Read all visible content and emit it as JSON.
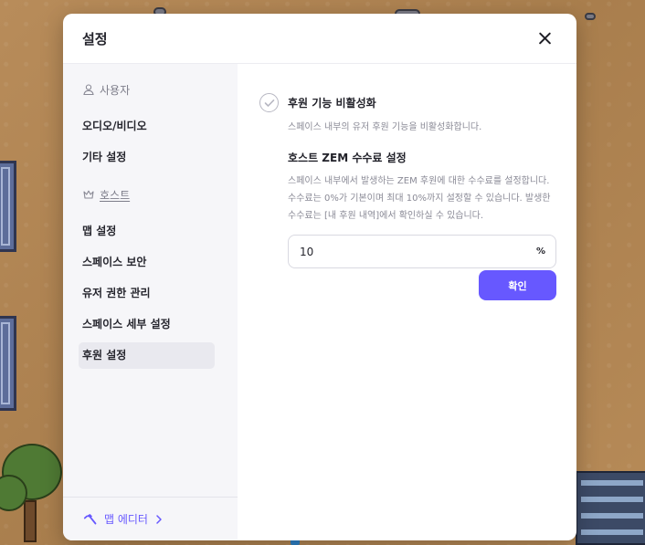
{
  "modal": {
    "title": "설정",
    "close_label": "close"
  },
  "sidebar": {
    "user_section": {
      "label": "사용자",
      "icon": "user-icon"
    },
    "user_items": [
      {
        "label": "오디오/비디오"
      },
      {
        "label": "기타 설정"
      }
    ],
    "host_section": {
      "label": "호스트",
      "icon": "crown-icon"
    },
    "host_items": [
      {
        "label": "맵 설정"
      },
      {
        "label": "스페이스 보안"
      },
      {
        "label": "유저 권한 관리"
      },
      {
        "label": "스페이스 세부 설정"
      },
      {
        "label": "후원 설정",
        "active": true
      }
    ],
    "footer": {
      "label": "맵 에디터",
      "icon": "hammer-icon",
      "chevron": "chevron-right-icon"
    }
  },
  "content": {
    "disable_toggle": {
      "title": "후원 기능 비활성화",
      "description": "스페이스 내부의 유저 후원 기능을 비활성화합니다.",
      "checked": false
    },
    "fee": {
      "title": "호스트 ZEM 수수료 설정",
      "description": "스페이스 내부에서 발생하는 ZEM 후원에 대한 수수료를 설정합니다. 수수료는 0%가 기본이며 최대 10%까지 설정할 수 있습니다. 발생한 수수료는 [내 후원 내역]에서 확인하실 수 있습니다.",
      "value": "10",
      "unit": "%"
    },
    "confirm_label": "확인"
  },
  "colors": {
    "accent": "#6758ff",
    "sidebar_bg": "#f6f6f9",
    "active_item_bg": "#e9e9ef"
  }
}
